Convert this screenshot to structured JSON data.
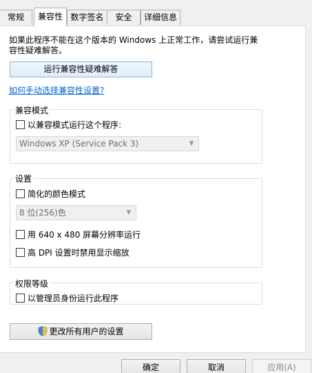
{
  "tabs": [
    {
      "label": "常规",
      "active": false
    },
    {
      "label": "兼容性",
      "active": true
    },
    {
      "label": "数字签名",
      "active": false
    },
    {
      "label": "安全",
      "active": false
    },
    {
      "label": "详细信息",
      "active": false
    }
  ],
  "intro_text": "如果此程序不能在这个版本的 Windows 上正常工作，请尝试运行兼容性疑难解答。",
  "troubleshoot_button": "运行兼容性疑难解答",
  "manual_link": "如何手动选择兼容性设置?",
  "compat_mode": {
    "title": "兼容模式",
    "checkbox_label": "以兼容模式运行这个程序:",
    "checked": false,
    "os_select": "Windows XP (Service Pack 3)"
  },
  "settings": {
    "title": "设置",
    "reduced_color_label": "简化的颜色模式",
    "reduced_color_checked": false,
    "color_select": "8 位(256)色",
    "resolution_label": "用 640 x 480 屏幕分辨率运行",
    "resolution_checked": false,
    "dpi_label": "高 DPI 设置时禁用显示缩放",
    "dpi_checked": false
  },
  "privilege": {
    "title": "权限等级",
    "admin_label": "以管理员身份运行此程序",
    "admin_checked": false
  },
  "all_users_button": "更改所有用户的设置",
  "footer": {
    "ok": "确定",
    "cancel": "取消",
    "apply": "应用(A)"
  },
  "colors": {
    "link": "#0066cc",
    "panel_bg": "#ffffff",
    "window_bg": "#f0f0f0"
  }
}
